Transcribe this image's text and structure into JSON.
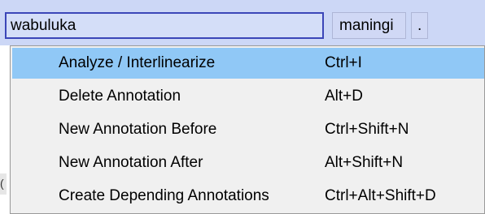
{
  "annotation_row": {
    "main_value": "wabuluka",
    "cells": [
      "maningi",
      "."
    ]
  },
  "left_edge_glyph": "(",
  "context_menu": {
    "items": [
      {
        "label": "Analyze / Interlinearize",
        "shortcut": "Ctrl+I",
        "selected": true
      },
      {
        "label": "Delete Annotation",
        "shortcut": "Alt+D",
        "selected": false
      },
      {
        "label": "New Annotation Before",
        "shortcut": "Ctrl+Shift+N",
        "selected": false
      },
      {
        "label": "New Annotation After",
        "shortcut": "Alt+Shift+N",
        "selected": false
      },
      {
        "label": "Create Depending Annotations",
        "shortcut": "Ctrl+Alt+Shift+D",
        "selected": false
      }
    ]
  },
  "colors": {
    "row_background": "#ccd7f6",
    "active_border": "#3b46b8",
    "menu_background": "#f0f0f0",
    "selected_item": "#90c8f6"
  }
}
